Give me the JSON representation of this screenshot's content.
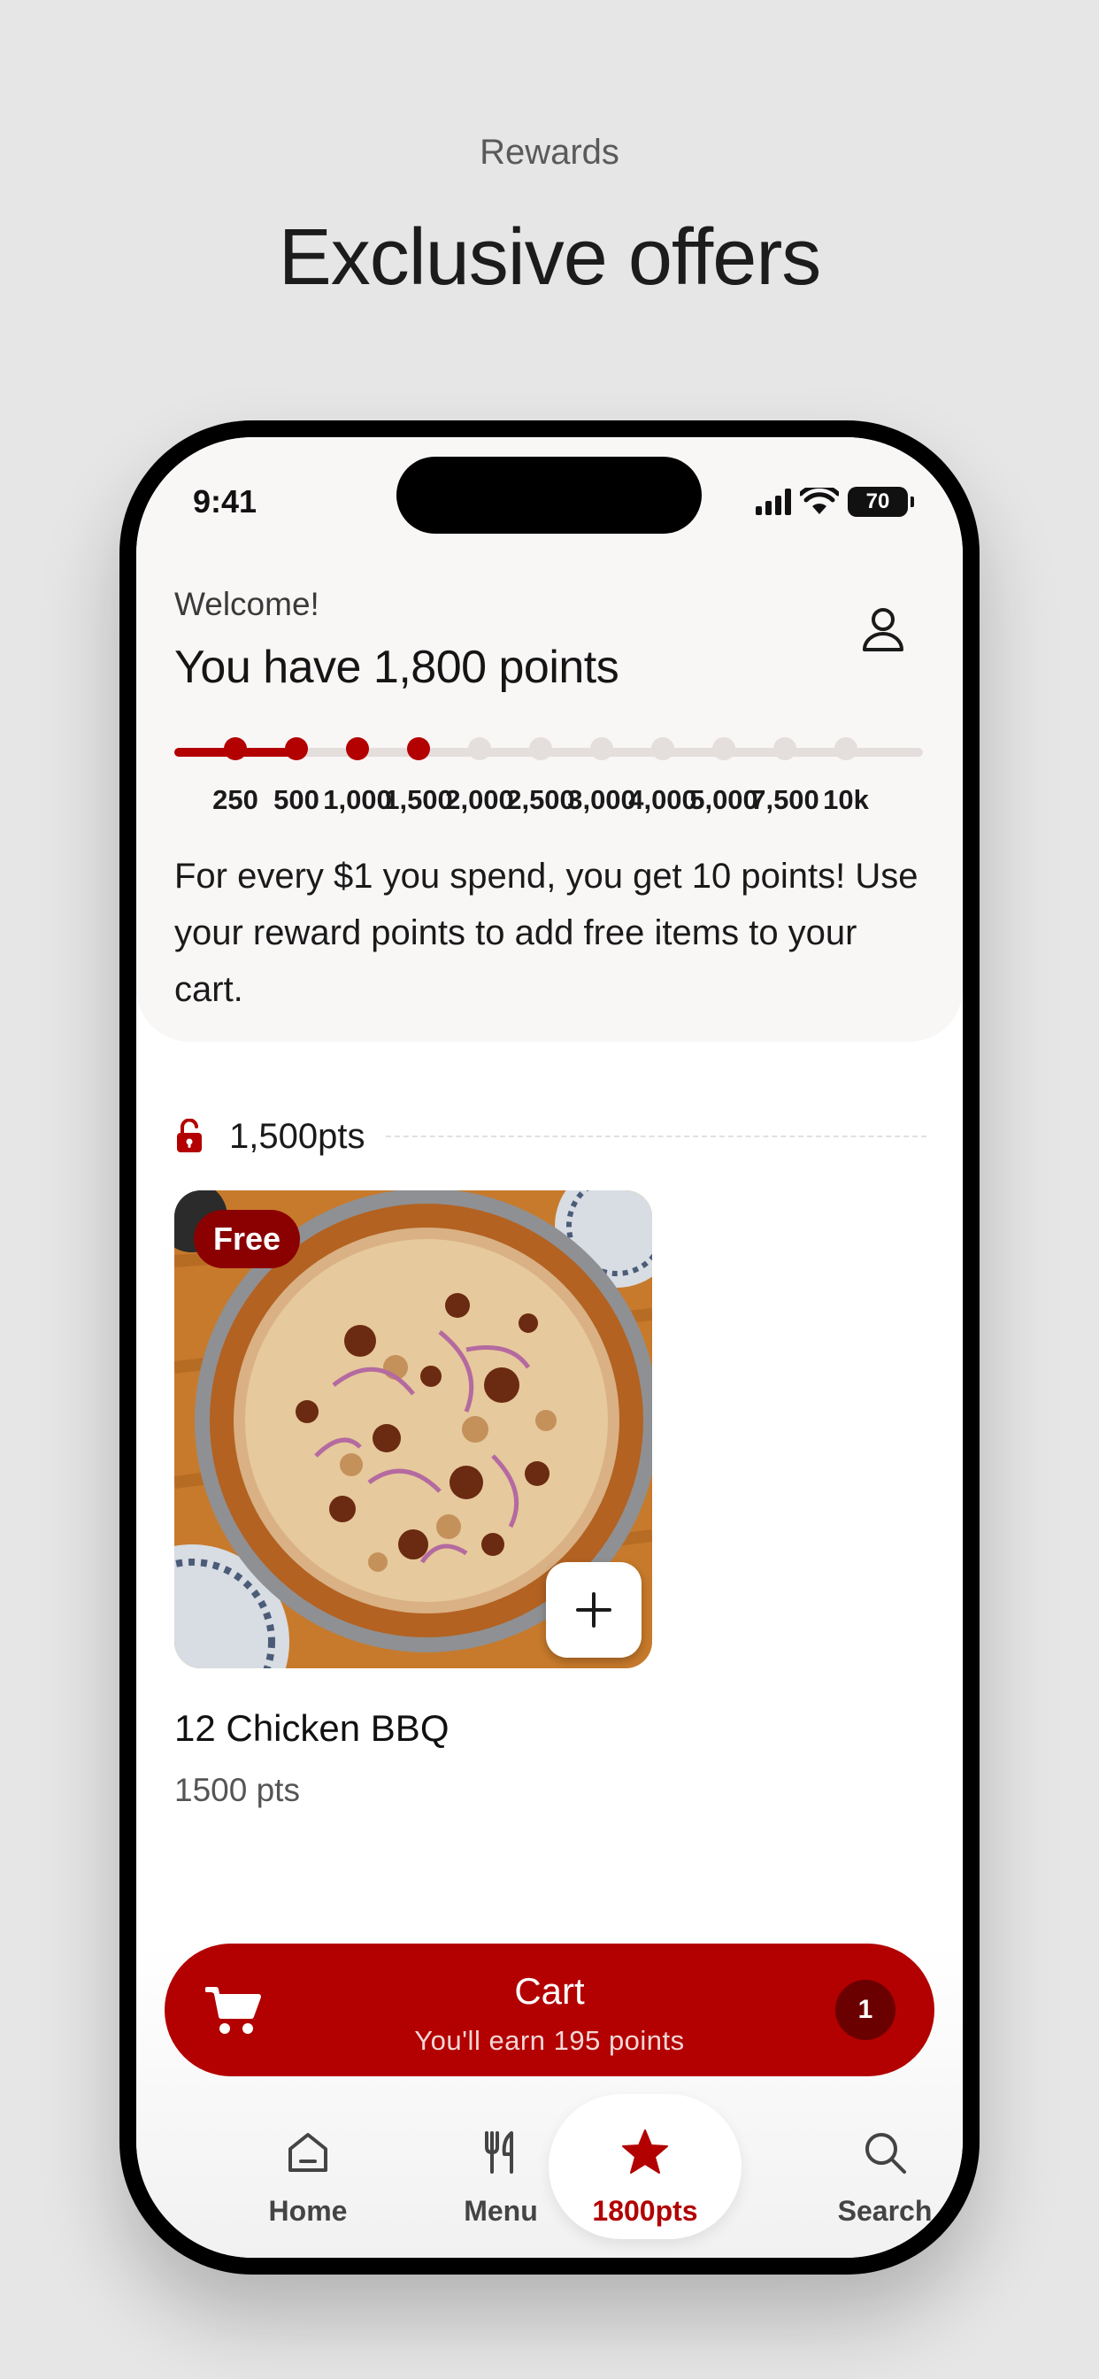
{
  "promo": {
    "subtitle": "Rewards",
    "title": "Exclusive offers"
  },
  "status_bar": {
    "time": "9:41",
    "battery": "70"
  },
  "header": {
    "welcome": "Welcome!",
    "points_headline": "You have 1,800 points"
  },
  "rewards_progress": {
    "current_points": 1800,
    "fill_fraction": 0.17,
    "milestones": [
      {
        "label": "250",
        "reached": true
      },
      {
        "label": "500",
        "reached": true
      },
      {
        "label": "1,000",
        "reached": true
      },
      {
        "label": "1,500",
        "reached": true
      },
      {
        "label": "2,000",
        "reached": false
      },
      {
        "label": "2,500",
        "reached": false
      },
      {
        "label": "3,000",
        "reached": false
      },
      {
        "label": "4,000",
        "reached": false
      },
      {
        "label": "5,000",
        "reached": false
      },
      {
        "label": "7,500",
        "reached": false
      },
      {
        "label": "10k",
        "reached": false
      }
    ]
  },
  "info": {
    "text": "For every $1 you spend, you get 10 points! Use your reward points to add free items to your cart."
  },
  "tier": {
    "label": "1,500pts",
    "icon": "lock-open-icon"
  },
  "reward_item": {
    "badge": "Free",
    "name": "12 Chicken BBQ",
    "points": "1500 pts",
    "add_icon": "plus-icon"
  },
  "cart": {
    "title": "Cart",
    "subtitle": "You'll earn 195 points",
    "count": "1"
  },
  "tabs": [
    {
      "label": "Home",
      "icon": "home-icon",
      "active": false
    },
    {
      "label": "Menu",
      "icon": "fork-knife-icon",
      "active": false
    },
    {
      "label": "1800pts",
      "icon": "star-icon",
      "active": true
    },
    {
      "label": "Search",
      "icon": "search-icon",
      "active": false
    }
  ],
  "colors": {
    "brand": "#b30000",
    "badge": "#8b0000",
    "track": "#e4dedd"
  }
}
